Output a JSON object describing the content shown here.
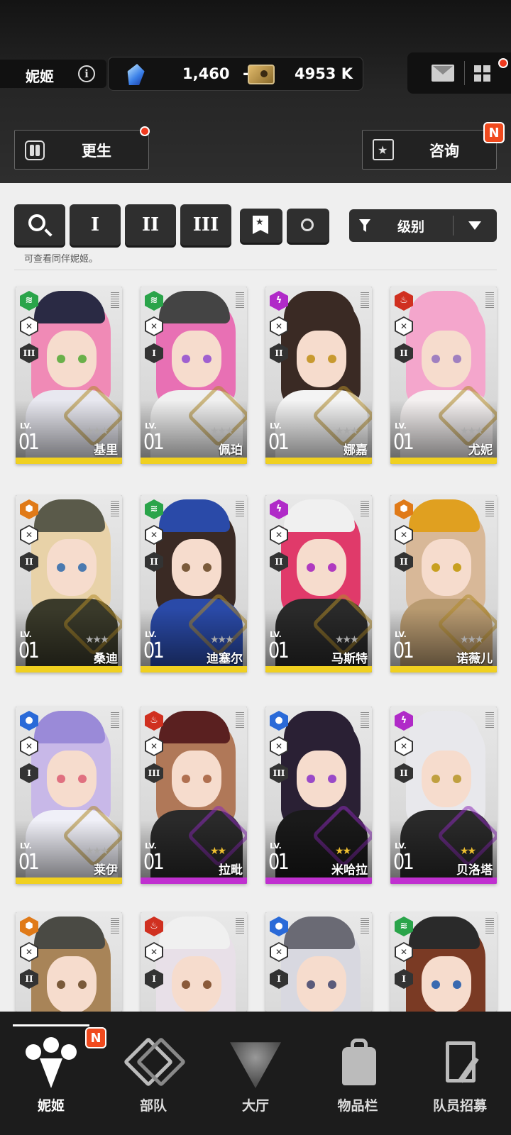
{
  "header": {
    "title": "妮姬",
    "gems": "1,460",
    "add_label": "+",
    "credits": "4953 K",
    "rebirth_label": "更生",
    "consult_label": "咨询",
    "consult_badge": "N"
  },
  "filters": {
    "burst_1": "I",
    "burst_2": "II",
    "burst_3": "III",
    "sort_label": "级别",
    "hint": "可查看同伴妮姬。"
  },
  "cards": [
    {
      "name": "基里",
      "level_label": "LV.",
      "level": "01",
      "element": "wind",
      "element_color": "#2aa44a",
      "burst": "III",
      "rarity": "SR",
      "bar_color": "#f0d020",
      "stars": "★★★",
      "hair": "#f08ab6",
      "hat": "#2a2a44",
      "body": "#e8e8f0",
      "eye": "#6ab04a"
    },
    {
      "name": "佩珀",
      "level_label": "LV.",
      "level": "01",
      "element": "wind",
      "element_color": "#2aa44a",
      "burst": "I",
      "rarity": "SR",
      "bar_color": "#f0d020",
      "stars": "★★★",
      "hair": "#e870b4",
      "hat": "#444",
      "body": "#f0f0f0",
      "eye": "#a060d0"
    },
    {
      "name": "娜嘉",
      "level_label": "LV.",
      "level": "01",
      "element": "electric",
      "element_color": "#b02ac8",
      "burst": "II",
      "rarity": "SR",
      "bar_color": "#f0d020",
      "stars": "★★★",
      "hair": "#3a2a24",
      "hat": "#3a2a24",
      "body": "#f4f4f4",
      "eye": "#c89a30"
    },
    {
      "name": "尤妮",
      "level_label": "LV.",
      "level": "01",
      "element": "fire",
      "element_color": "#d03020",
      "burst": "II",
      "rarity": "SR",
      "bar_color": "#f0d020",
      "stars": "★★★",
      "hair": "#f4a6cc",
      "hat": "#f4a6cc",
      "body": "#f4f0f0",
      "eye": "#a080c0"
    },
    {
      "name": "桑迪",
      "level_label": "LV.",
      "level": "01",
      "element": "iron",
      "element_color": "#e07a18",
      "burst": "II",
      "rarity": "SR",
      "bar_color": "#f0d020",
      "stars": "★★★",
      "hair": "#e8d2a8",
      "hat": "#5a5a4a",
      "body": "#3a3a2a",
      "eye": "#4a7ab0"
    },
    {
      "name": "迪塞尔",
      "level_label": "LV.",
      "level": "01",
      "element": "wind",
      "element_color": "#2aa44a",
      "burst": "II",
      "rarity": "SR",
      "bar_color": "#f0d020",
      "stars": "★★★",
      "hair": "#3a2a24",
      "hat": "#2a4aa8",
      "body": "#2a4aa8",
      "eye": "#7a5a3a"
    },
    {
      "name": "马斯特",
      "level_label": "LV.",
      "level": "01",
      "element": "electric",
      "element_color": "#b02ac8",
      "burst": "II",
      "rarity": "SR",
      "bar_color": "#f0d020",
      "stars": "★★★",
      "hair": "#e03a6a",
      "hat": "#f0f0f0",
      "body": "#2a2a2a",
      "eye": "#b03ac0"
    },
    {
      "name": "诺薇儿",
      "level_label": "LV.",
      "level": "01",
      "element": "iron",
      "element_color": "#e07a18",
      "burst": "II",
      "rarity": "SR",
      "bar_color": "#f0d020",
      "stars": "★★★",
      "hair": "#d8b898",
      "hat": "#e0a020",
      "body": "#b89a70",
      "eye": "#c8a020"
    },
    {
      "name": "莱伊",
      "level_label": "LV.",
      "level": "01",
      "element": "water",
      "element_color": "#2a6ad8",
      "burst": "I",
      "rarity": "SR",
      "bar_color": "#f0d020",
      "stars": "★★★",
      "hair": "#c8b8e8",
      "hat": "#9a8ad8",
      "body": "#f0f0f8",
      "eye": "#e07080"
    },
    {
      "name": "拉毗",
      "level_label": "LV.",
      "level": "01",
      "element": "fire",
      "element_color": "#d03020",
      "burst": "III",
      "rarity": "R",
      "bar_color": "#c030d0",
      "stars": "★★",
      "hair": "#b07858",
      "hat": "#5a2020",
      "body": "#2a2a2a",
      "eye": "#b07050"
    },
    {
      "name": "米哈拉",
      "level_label": "LV.",
      "level": "01",
      "element": "water",
      "element_color": "#2a6ad8",
      "burst": "III",
      "rarity": "R",
      "bar_color": "#c030d0",
      "stars": "★★",
      "hair": "#2a2034",
      "hat": "#2a2034",
      "body": "#1a1a1a",
      "eye": "#9a4ac8"
    },
    {
      "name": "贝洛塔",
      "level_label": "LV.",
      "level": "01",
      "element": "electric",
      "element_color": "#b02ac8",
      "burst": "II",
      "rarity": "R",
      "bar_color": "#c030d0",
      "stars": "★★",
      "hair": "#e8e8ec",
      "hat": "#e8e8ec",
      "body": "#2a2a2a",
      "eye": "#c0a040"
    },
    {
      "name": "",
      "level_label": "",
      "level": "",
      "element": "iron",
      "element_color": "#e07a18",
      "burst": "II",
      "rarity": "",
      "bar_color": "",
      "stars": "",
      "hair": "#a88458",
      "hat": "#4a4a44",
      "body": "#4a4a44",
      "eye": "#7a5a3a"
    },
    {
      "name": "",
      "level_label": "",
      "level": "",
      "element": "fire",
      "element_color": "#d03020",
      "burst": "I",
      "rarity": "",
      "bar_color": "",
      "stars": "",
      "hair": "#e8e0e8",
      "hat": "#f0f0f0",
      "body": "#f0f0f0",
      "eye": "#8a5a3a"
    },
    {
      "name": "",
      "level_label": "",
      "level": "",
      "element": "water",
      "element_color": "#2a6ad8",
      "burst": "I",
      "rarity": "",
      "bar_color": "",
      "stars": "",
      "hair": "#d8d8e0",
      "hat": "#6a6a74",
      "body": "#6a6a74",
      "eye": "#5a5a7a"
    },
    {
      "name": "",
      "level_label": "",
      "level": "",
      "element": "wind",
      "element_color": "#2aa44a",
      "burst": "I",
      "rarity": "",
      "bar_color": "",
      "stars": "",
      "hair": "#7a3a24",
      "hat": "#2a2a2a",
      "body": "#2a2a2a",
      "eye": "#3a6ab0"
    }
  ],
  "nav": {
    "items": [
      {
        "label": "妮姬",
        "icon": "nikke-icon",
        "active": true,
        "badge": "N"
      },
      {
        "label": "部队",
        "icon": "squad-icon",
        "active": false
      },
      {
        "label": "大厅",
        "icon": "lobby-icon",
        "active": false
      },
      {
        "label": "物品栏",
        "icon": "inventory-icon",
        "active": false
      },
      {
        "label": "队员招募",
        "icon": "recruit-icon",
        "active": false
      }
    ]
  },
  "colors": {
    "accent_red": "#f03a1e",
    "panel_bg": "#efefef",
    "dark_bg": "#1c1c1c"
  }
}
